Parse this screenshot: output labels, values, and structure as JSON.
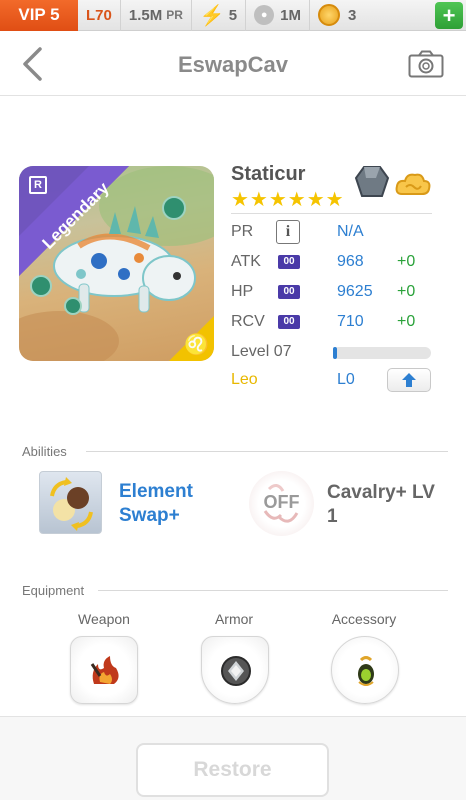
{
  "statusbar": {
    "vip": "VIP 5",
    "level": "L70",
    "power": "1.5M",
    "power_unit": "PR",
    "energy": "5",
    "food": "1M",
    "coins": "3",
    "add_label": "+"
  },
  "header": {
    "title": "EswapCav"
  },
  "familiar": {
    "rarity": "Legendary",
    "name": "Staticur",
    "stars": "★★★★★★",
    "zodiac_symbol": "♌"
  },
  "stats": {
    "pr_label": "PR",
    "pr_value": "N/A",
    "atk_label": "ATK",
    "atk_box": "00",
    "atk_value": "968",
    "atk_bonus": "+0",
    "hp_label": "HP",
    "hp_box": "00",
    "hp_value": "9625",
    "hp_bonus": "+0",
    "rcv_label": "RCV",
    "rcv_box": "00",
    "rcv_value": "710",
    "rcv_bonus": "+0",
    "level_label": "Level 07",
    "level_progress": 0.02,
    "sign_label": "Leo",
    "sign_level": "L0"
  },
  "abilities": {
    "heading": "Abilities",
    "active_name": "Element Swap+",
    "passive_state": "OFF",
    "passive_name": "Cavalry+ LV 1"
  },
  "equipment": {
    "heading": "Equipment",
    "weapon_label": "Weapon",
    "armor_label": "Armor",
    "accessory_label": "Accessory"
  },
  "footer": {
    "restore_label": "Restore"
  },
  "colors": {
    "accent_blue": "#2d7fd1",
    "vip_orange": "#e04e14",
    "bonus_green": "#2aa23a",
    "rarity_purple": "#6c4fc0",
    "star_gold": "#f5c400"
  }
}
